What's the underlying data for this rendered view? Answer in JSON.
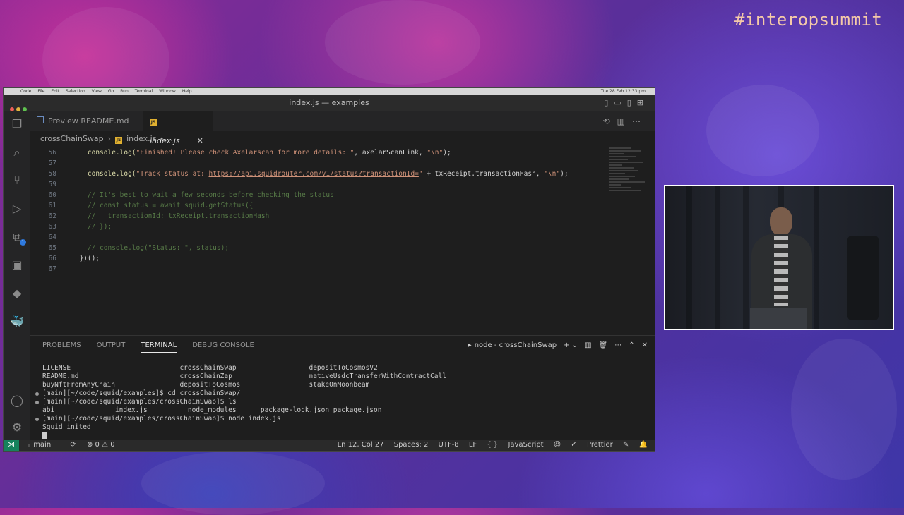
{
  "event": {
    "hashtag": "#interopsummit"
  },
  "macos_menu": {
    "items": [
      "Code",
      "File",
      "Edit",
      "Selection",
      "View",
      "Go",
      "Run",
      "Terminal",
      "Window",
      "Help"
    ],
    "clock": "Tue 28 Feb  12:33 pm"
  },
  "window": {
    "title": "index.js — examples"
  },
  "tabs": [
    {
      "label": "Preview README.md",
      "active": false
    },
    {
      "label": "index.js",
      "active": true
    }
  ],
  "breadcrumb": {
    "folder": "crossChainSwap",
    "file": "index.js",
    "more": "..."
  },
  "activity_bar": {
    "icons": [
      "files-icon",
      "search-icon",
      "source-control-icon",
      "run-debug-icon",
      "extensions-icon",
      "remote-explorer-icon",
      "terraform-icon",
      "docker-icon"
    ],
    "extensions_badge": "1"
  },
  "editor": {
    "lines": [
      {
        "n": "56",
        "segments": [
          {
            "t": "    ",
            "c": "plain"
          },
          {
            "t": "console.log(",
            "c": "fn"
          },
          {
            "t": "\"Finished! Please check Axelarscan for more details: \"",
            "c": "str"
          },
          {
            "t": ", axelarScanLink, ",
            "c": "plain"
          },
          {
            "t": "\"\\n\"",
            "c": "str"
          },
          {
            "t": ");",
            "c": "plain"
          }
        ]
      },
      {
        "n": "57",
        "segments": []
      },
      {
        "n": "58",
        "segments": [
          {
            "t": "    ",
            "c": "plain"
          },
          {
            "t": "console.log(",
            "c": "fn"
          },
          {
            "t": "\"Track status at: ",
            "c": "str"
          },
          {
            "t": "https://api.squidrouter.com/v1/status?transactionId=",
            "c": "link"
          },
          {
            "t": "\"",
            "c": "str"
          },
          {
            "t": " + txReceipt.transactionHash, ",
            "c": "plain"
          },
          {
            "t": "\"\\n\"",
            "c": "str"
          },
          {
            "t": ");",
            "c": "plain"
          }
        ]
      },
      {
        "n": "59",
        "segments": []
      },
      {
        "n": "60",
        "segments": [
          {
            "t": "    // It's best to wait a few seconds before checking the status",
            "c": "cmt"
          }
        ]
      },
      {
        "n": "61",
        "segments": [
          {
            "t": "    // const status = await squid.getStatus({",
            "c": "cmt"
          }
        ]
      },
      {
        "n": "62",
        "segments": [
          {
            "t": "    //   transactionId: txReceipt.transactionHash",
            "c": "cmt"
          }
        ]
      },
      {
        "n": "63",
        "segments": [
          {
            "t": "    // });",
            "c": "cmt"
          }
        ]
      },
      {
        "n": "64",
        "segments": []
      },
      {
        "n": "65",
        "segments": [
          {
            "t": "    // console.log(\"Status: \", status);",
            "c": "cmt"
          }
        ]
      },
      {
        "n": "66",
        "segments": [
          {
            "t": "  })();",
            "c": "plain"
          }
        ]
      },
      {
        "n": "67",
        "segments": []
      }
    ]
  },
  "panel": {
    "tabs": [
      "PROBLEMS",
      "OUTPUT",
      "TERMINAL",
      "DEBUG CONSOLE"
    ],
    "active_tab": "TERMINAL",
    "terminal_name": "node - crossChainSwap"
  },
  "terminal": {
    "lines": [
      "LICENSE                           crossChainSwap                  depositToCosmosV2",
      "README.md                         crossChainZap                   nativeUsdcTransferWithContractCall",
      "buyNftFromAnyChain                depositToCosmos                 stakeOnMoonbeam",
      "[main][~/code/squid/examples]$ cd crossChainSwap/",
      "[main][~/code/squid/examples/crossChainSwap]$ ls",
      "abi               index.js          node_modules      package-lock.json package.json",
      "[main][~/code/squid/examples/crossChainSwap]$ node index.js",
      "Squid inited"
    ]
  },
  "status_bar": {
    "branch": "main",
    "problems": "⊗ 0 ⚠ 0",
    "position": "Ln 12, Col 27",
    "spaces": "Spaces: 2",
    "encoding": "UTF-8",
    "eol": "LF",
    "language": "JavaScript",
    "formatter": "Prettier"
  }
}
